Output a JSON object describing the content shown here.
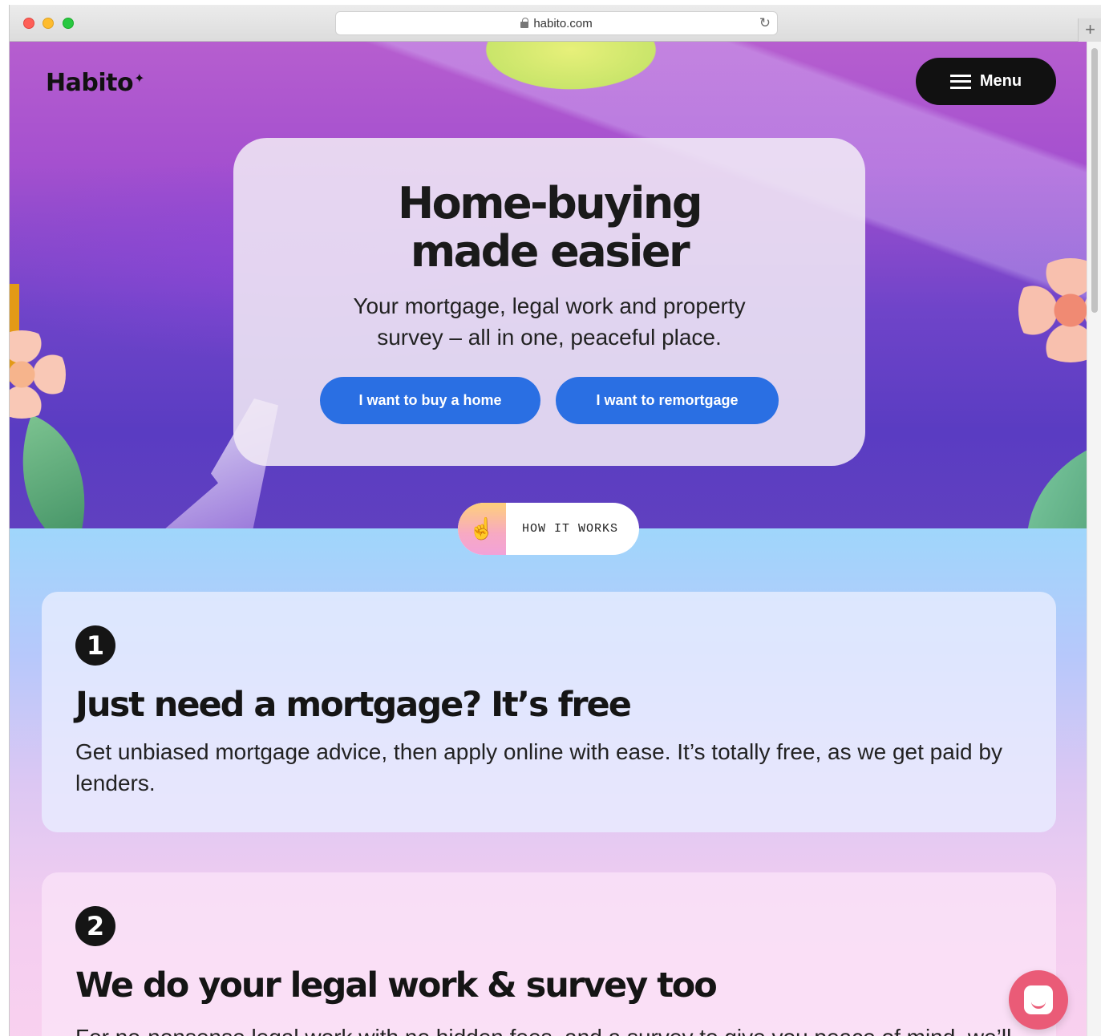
{
  "browser": {
    "url": "habito.com",
    "reload_icon": "reload-icon",
    "new_tab_label": "+"
  },
  "header": {
    "logo_text": "Habito",
    "logo_mark": "✦",
    "menu_label": "Menu"
  },
  "hero": {
    "title": "Home-buying made easier",
    "subtitle": "Your mortgage, legal work and property survey – all in one, peaceful place.",
    "cta_buy": "I want to buy a home",
    "cta_remortgage": "I want to remortgage"
  },
  "how_it_works": {
    "icon": "pointing-hand-icon",
    "icon_glyph": "☝",
    "label": "HOW IT WORKS"
  },
  "steps": [
    {
      "number": "1",
      "title": "Just need a mortgage? It’s free",
      "text": "Get unbiased mortgage advice, then apply online with ease. It’s totally free, as we get paid by lenders."
    },
    {
      "number": "2",
      "title": "We do your legal work & survey too",
      "text": "For no-nonsense legal work with no hidden fees, and a survey to give you peace of mind, we’ll get it all sorted."
    }
  ],
  "colors": {
    "cta_blue": "#2a6fe3",
    "menu_black": "#111111",
    "chat_pink": "#ea5b77",
    "hero_purple": "#6f44c9",
    "lower_blue": "#9fd6fb"
  }
}
